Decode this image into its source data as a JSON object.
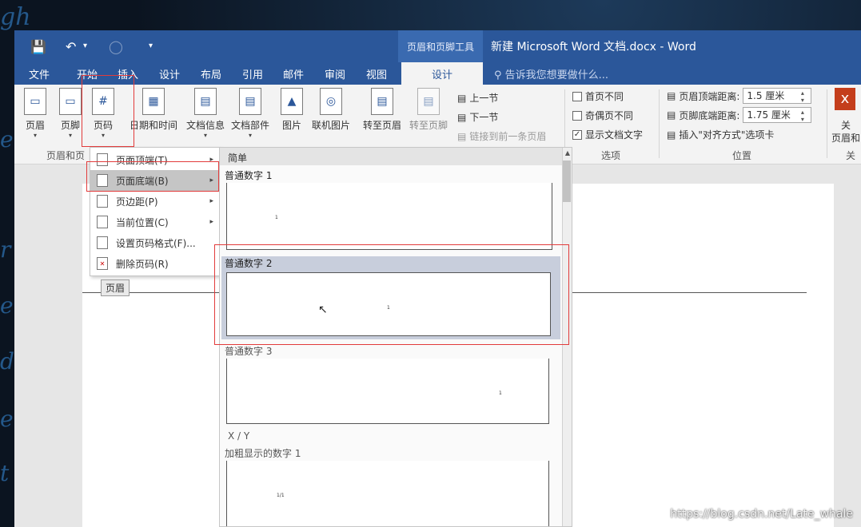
{
  "background": {
    "handwriting": [
      "gh",
      "e",
      "r",
      "e",
      "d",
      "e",
      "t"
    ]
  },
  "titlebar": {
    "save_icon": "save-icon",
    "undo_icon": "undo-icon",
    "context_tab_label": "页眉和页脚工具",
    "doc_title": "新建 Microsoft Word 文档.docx - Word"
  },
  "tabs": {
    "items": [
      "文件",
      "开始",
      "插入",
      "设计",
      "布局",
      "引用",
      "邮件",
      "审阅",
      "视图"
    ],
    "active": "设计",
    "tell_me": "告诉我您想要做什么..."
  },
  "ribbon": {
    "buttons": {
      "header": "页眉",
      "footer": "页脚",
      "page_number": "页码",
      "date_time": "日期和时间",
      "doc_info": "文档信息",
      "doc_parts": "文档部件",
      "picture": "图片",
      "online_picture": "联机图片",
      "goto_header": "转至页眉",
      "goto_footer": "转至页脚"
    },
    "nav": {
      "prev": "上一节",
      "next": "下一节",
      "link_prev": "链接到前一条页眉"
    },
    "options": {
      "different_first": "首页不同",
      "different_odd_even": "奇偶页不同",
      "show_doc_text": "显示文档文字",
      "show_doc_text_checked": true
    },
    "position": {
      "header_top_label": "页眉顶端距离:",
      "header_top_value": "1.5 厘米",
      "footer_bottom_label": "页脚底端距离:",
      "footer_bottom_value": "1.75 厘米",
      "insert_align_tab": "插入\"对齐方式\"选项卡"
    },
    "close_label": "关",
    "close_sub": "页眉和",
    "close_group": "关",
    "group_labels": {
      "header_footer": "页眉和页",
      "options": "选项",
      "position": "位置"
    }
  },
  "menu": {
    "items": [
      {
        "label": "页面顶端(T)",
        "has_submenu": true
      },
      {
        "label": "页面底端(B)",
        "has_submenu": true,
        "highlighted": true
      },
      {
        "label": "页边距(P)",
        "has_submenu": true
      },
      {
        "label": "当前位置(C)",
        "has_submenu": true
      },
      {
        "label": "设置页码格式(F)...",
        "has_submenu": false
      },
      {
        "label": "删除页码(R)",
        "has_submenu": false
      }
    ],
    "header_tag": "页眉"
  },
  "gallery": {
    "section": "简单",
    "items": [
      {
        "label": "普通数字 1",
        "sample": "1"
      },
      {
        "label": "普通数字 2",
        "sample": "1"
      },
      {
        "label": "普通数字 3",
        "sample": "1"
      }
    ],
    "section2": "X / Y",
    "items2": [
      {
        "label": "加粗显示的数字 1",
        "sample": "1/1"
      }
    ]
  },
  "watermark": "https://blog.csdn.net/Late_whale",
  "colors": {
    "accent": "#2b579a",
    "highlight_box": "#e23b3b"
  }
}
